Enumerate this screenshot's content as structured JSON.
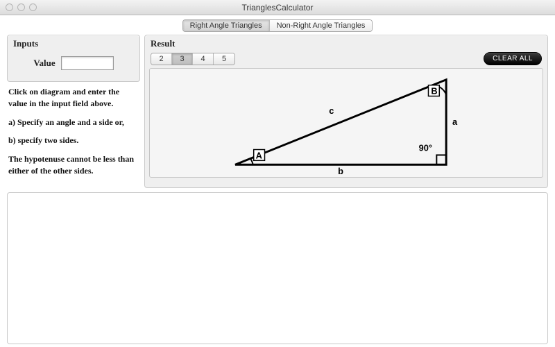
{
  "window": {
    "title": "TrianglesCalculator"
  },
  "tabs": {
    "items": [
      "Right Angle Triangles",
      "Non-Right Angle Triangles"
    ],
    "selected": 0
  },
  "inputs": {
    "header": "Inputs",
    "value_label": "Value",
    "value": ""
  },
  "instructions": {
    "line1": "Click on diagram and enter the value in the input field above.",
    "line2": "a) Specify an angle and a side or,",
    "line3": "b) specify two sides.",
    "line4": "The hypotenuse cannot be less than either of the other sides."
  },
  "result": {
    "header": "Result",
    "decimals": {
      "options": [
        "2",
        "3",
        "4",
        "5"
      ],
      "selected": 1
    },
    "clear_label": "CLEAR ALL",
    "triangle": {
      "vertex_A": "A",
      "vertex_B": "B",
      "side_a": "a",
      "side_b": "b",
      "side_c": "c",
      "right_angle": "90°"
    }
  }
}
